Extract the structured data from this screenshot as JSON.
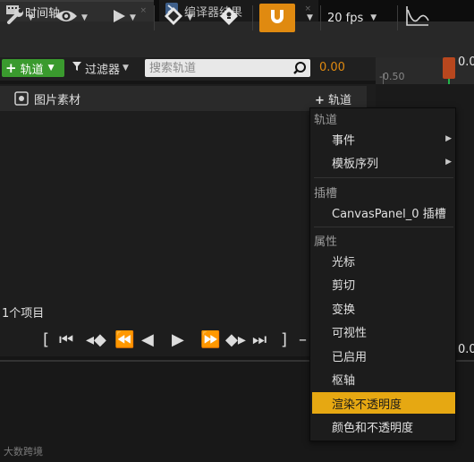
{
  "tabs": [
    {
      "label": "时间轴",
      "close": "×"
    },
    {
      "label": "编译器结果",
      "close": "×"
    }
  ],
  "toolbar": {
    "fps_label": "20 fps",
    "icons": [
      "wrench-icon",
      "eye-icon",
      "play-icon",
      "keyframe-icon",
      "snap-magnet-icon",
      "curve-editor-icon"
    ],
    "accent": "#e08a10"
  },
  "filter_row": {
    "add_track_label": "轨道",
    "filter_label": "过滤器",
    "search_placeholder": "搜索轨道",
    "current_time": "0.00"
  },
  "ruler": {
    "tick_label": "-0.50",
    "current_time": "0.0"
  },
  "outliner": {
    "image_row_label": "图片素材",
    "track_button_label": "轨道",
    "item_count": "1个项目"
  },
  "bottom_time": "0.0",
  "watermark": "大数跨境",
  "menu": {
    "sections": [
      {
        "header": "轨道",
        "items": [
          {
            "label": "事件",
            "submenu": true
          },
          {
            "label": "模板序列",
            "submenu": true
          }
        ]
      },
      {
        "header": "插槽",
        "items": [
          {
            "label": "CanvasPanel_0 插槽",
            "submenu": false
          }
        ]
      },
      {
        "header": "属性",
        "items": [
          {
            "label": "光标"
          },
          {
            "label": "剪切"
          },
          {
            "label": "变换"
          },
          {
            "label": "可视性"
          },
          {
            "label": "已启用"
          },
          {
            "label": "枢轴"
          },
          {
            "label": "渲染不透明度",
            "highlighted": true
          },
          {
            "label": "颜色和不透明度"
          }
        ]
      }
    ]
  }
}
